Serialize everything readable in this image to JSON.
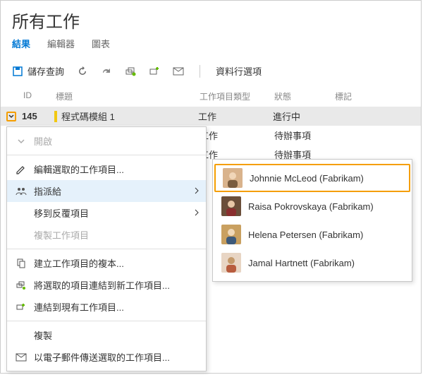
{
  "page_title": "所有工作",
  "tabs": {
    "results": "結果",
    "editor": "編輯器",
    "chart": "圖表"
  },
  "toolbar": {
    "save_query": "儲存查詢",
    "column_options": "資料行選項"
  },
  "columns": {
    "id": "ID",
    "title": "標題",
    "type": "工作項目類型",
    "state": "狀態",
    "tag": "標記"
  },
  "rows": [
    {
      "id": "145",
      "title": "程式碼模組 1",
      "type": "工作",
      "state": "進行中"
    },
    {
      "id": "",
      "title": "",
      "type": "工作",
      "state": "待辦事項"
    },
    {
      "id": "",
      "title": "",
      "type": "工作",
      "state": "待辦事項"
    }
  ],
  "menu": {
    "open": "開啟",
    "edit_selected": "編輯選取的工作項目...",
    "assign_to": "指派給",
    "move_to_iteration": "移到反覆項目",
    "copy_work_item": "複製工作項目",
    "create_copy": "建立工作項目的複本...",
    "link_new": "將選取的項目連結到新工作項目...",
    "link_existing": "連結到現有工作項目...",
    "copy": "複製",
    "email_selected": "以電子郵件傳送選取的工作項目..."
  },
  "assignees": [
    {
      "name": "Johnnie McLeod  (Fabrikam)"
    },
    {
      "name": "Raisa Pokrovskaya (Fabrikam)"
    },
    {
      "name": "Helena Petersen (Fabrikam)"
    },
    {
      "name": "Jamal Hartnett (Fabrikam)"
    }
  ]
}
